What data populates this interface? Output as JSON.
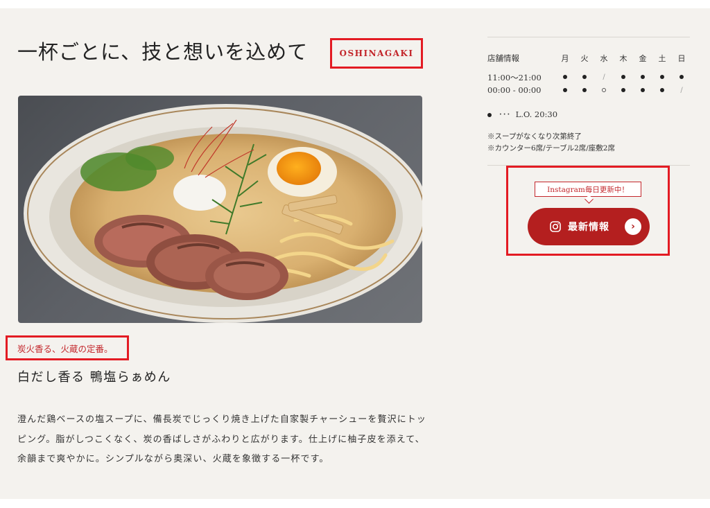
{
  "headline": "一杯ごとに、技と想いを込めて",
  "tag": "OSHINAGAKI",
  "photo": {
    "icon": "ramen-photo"
  },
  "dish": {
    "catch": "炭火香る、火蔵の定番。",
    "name": "白だし香る 鴨塩らぁめん",
    "description": "澄んだ鶏ベースの塩スープに、備長炭でじっくり焼き上げた自家製チャーシューを贅沢にトッピング。脂がしつこくなく、炭の香ばしさがふわりと広がります。仕上げに柚子皮を添えて、余韻まで爽やかに。シンプルながら奥深い、火蔵を象徴する一杯です。"
  },
  "store": {
    "label": "店舗情報",
    "days": [
      "月",
      "火",
      "水",
      "木",
      "金",
      "土",
      "日"
    ],
    "schedule": [
      {
        "time": "11:00〜21:00",
        "marks": [
          "dot",
          "dot",
          "slash",
          "dot",
          "dot",
          "dot",
          "dot"
        ]
      },
      {
        "time": "00:00 - 00:00",
        "marks": [
          "dot",
          "dot",
          "ring",
          "dot",
          "dot",
          "dot",
          "slash"
        ]
      }
    ],
    "legend_dots": "･･･",
    "last_order": "L.O. 20:30",
    "notes": [
      "※スープがなくなり次第終了",
      "※カウンター6席/テーブル2席/座敷2席"
    ]
  },
  "instagram": {
    "bubble": "Instagram毎日更新中！",
    "button": "最新情報",
    "icon": "instagram-icon",
    "arrow_icon": "chevron-right-icon"
  },
  "colors": {
    "accent": "#b41f1f",
    "highlight": "#e31b23",
    "background": "#f4f2ee"
  }
}
